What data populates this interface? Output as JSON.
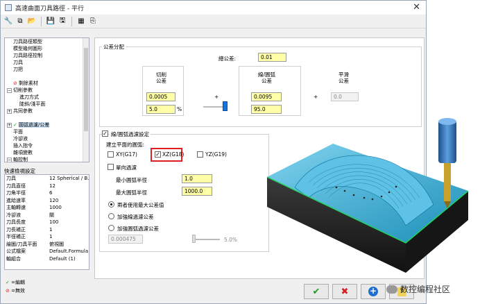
{
  "window": {
    "title": "高速曲面刀具路徑 - 平行"
  },
  "tree": [
    {
      "label": "刀具路徑類型",
      "indent": 1,
      "toggle": ""
    },
    {
      "label": "模型幾何圖形",
      "indent": 1,
      "toggle": ""
    },
    {
      "label": "刀具路徑控制",
      "indent": 1,
      "toggle": ""
    },
    {
      "label": "刀具",
      "indent": 1,
      "toggle": ""
    },
    {
      "label": "刀把",
      "indent": 1,
      "toggle": ""
    },
    {
      "label": "",
      "indent": 1,
      "toggle": ""
    },
    {
      "label": "剩餘素材",
      "indent": 1,
      "toggle": "",
      "mark": "⊘"
    },
    {
      "label": "切削參數",
      "indent": 0,
      "toggle": "−"
    },
    {
      "label": "進刀方式",
      "indent": 2,
      "toggle": ""
    },
    {
      "label": "陡斜/淺平面",
      "indent": 2,
      "toggle": ""
    },
    {
      "label": "共同參數",
      "indent": 0,
      "toggle": "+"
    },
    {
      "label": "",
      "indent": 1,
      "toggle": ""
    },
    {
      "label": "圓弧過濾/公差",
      "indent": 0,
      "toggle": "+",
      "mark": "✓",
      "selected": true
    },
    {
      "label": "平面",
      "indent": 1,
      "toggle": ""
    },
    {
      "label": "冷卻液",
      "indent": 1,
      "toggle": ""
    },
    {
      "label": "插入指令",
      "indent": 1,
      "toggle": ""
    },
    {
      "label": "雜項變數",
      "indent": 1,
      "toggle": ""
    },
    {
      "label": "軸控制",
      "indent": 0,
      "toggle": "−"
    },
    {
      "label": "軸組合",
      "indent": 2,
      "toggle": ""
    }
  ],
  "quick": {
    "title": "快速檢視設定",
    "rows": [
      {
        "k": "刀具",
        "v": "12 Spherical / B..."
      },
      {
        "k": "刀具直徑",
        "v": "12"
      },
      {
        "k": "刀角半徑",
        "v": "6"
      },
      {
        "k": "進給速率",
        "v": "120"
      },
      {
        "k": "主軸轉速",
        "v": "1000"
      },
      {
        "k": "冷卻液",
        "v": "關"
      },
      {
        "k": "刀具長度",
        "v": "100"
      },
      {
        "k": "刀長補正",
        "v": "1"
      },
      {
        "k": "半徑補正",
        "v": "1"
      },
      {
        "k": "繪圖/刀具平面",
        "v": "俯視圖"
      },
      {
        "k": "公式檔案",
        "v": "Default.Formula"
      },
      {
        "k": "軸組合",
        "v": "Default (1)"
      }
    ]
  },
  "legend": {
    "ok": "=編輯",
    "no": "=無效"
  },
  "tol": {
    "group_label": "公差分配",
    "total_label": "總公差:",
    "total_value": "0.01",
    "cut_label1": "切削",
    "cut_label2": "公差",
    "cut_value": "0.0005",
    "cut_pct": "5.0",
    "pct": "%",
    "plus": "+",
    "plus2": "+",
    "line_label1": "線/圓弧",
    "line_label2": "公差",
    "line_value": "0.0095",
    "line_pct": "95.0",
    "smooth_label1": "平滑",
    "smooth_label2": "公差",
    "smooth_value": "0.0",
    "slider_fraction": 0.95
  },
  "arc": {
    "title": "線/圓弧過濾設定",
    "plane_label": "建立平面的圓弧:",
    "xy": "XY(G17)",
    "xz": "XZ(G18)",
    "yz": "YZ(G19)",
    "single": "單向過濾",
    "min_label": "最小圓弧半徑",
    "min_value": "1.0",
    "max_label": "最大圓弧半徑",
    "max_value": "1000.0",
    "r1": "兩者使用最大公差值",
    "r2": "加強線過濾公差",
    "r3": "加強圓弧過濾公差",
    "dis_value": "0.000475",
    "dis_pct": "5.0%"
  },
  "buttons": {
    "ok": "✔",
    "cancel": "✖",
    "add": "+",
    "help": "?"
  },
  "watermark": "数控编程社区"
}
